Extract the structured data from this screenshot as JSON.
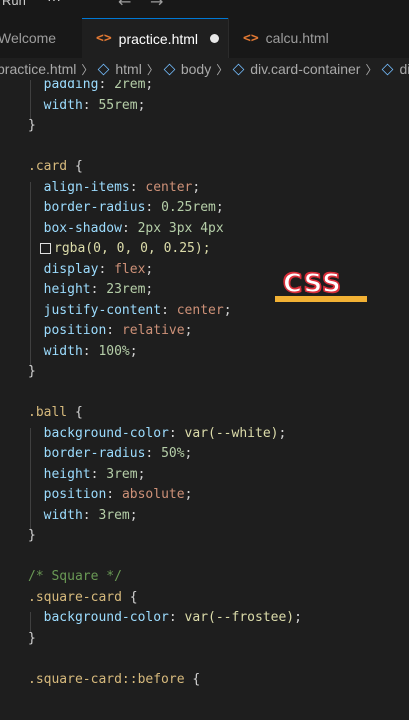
{
  "menubar": {
    "label": "Run",
    "more": "···",
    "back_icon": "arrow-left-icon",
    "forward_icon": "arrow-right-icon"
  },
  "tabs": [
    {
      "label": "Welcome",
      "active": false
    },
    {
      "label": "practice.html",
      "active": true,
      "dirty": true,
      "icon": "html-tag-icon"
    },
    {
      "label": "calcu.html",
      "active": false,
      "icon": "html-tag-icon"
    }
  ],
  "breadcrumb": [
    "practice.html",
    "html",
    "body",
    "div.card-container",
    "div"
  ],
  "badge": {
    "text": "CSS",
    "accent": "#f2b134"
  },
  "code": {
    "l1": [
      "padding",
      "2rem"
    ],
    "l2": [
      "width",
      "55rem"
    ],
    "card_selector": ".card",
    "card": [
      [
        "align-items",
        "center"
      ],
      [
        "border-radius",
        "0.25rem"
      ],
      [
        "box-shadow",
        "2px 3px 4px"
      ],
      [
        "display",
        "flex"
      ],
      [
        "height",
        "23rem"
      ],
      [
        "justify-content",
        "center"
      ],
      [
        "position",
        "relative"
      ],
      [
        "width",
        "100%"
      ]
    ],
    "shadow_rgba": "rgba(0, 0, 0, 0.25);",
    "ball_selector": ".ball",
    "ball": [
      [
        "background-color",
        "var(--white)"
      ],
      [
        "border-radius",
        "50%"
      ],
      [
        "height",
        "3rem"
      ],
      [
        "position",
        "absolute"
      ],
      [
        "width",
        "3rem"
      ]
    ],
    "comment": "/* Square */",
    "square_selector": ".square-card",
    "square": [
      [
        "background-color",
        "var(--frostee)"
      ]
    ],
    "before_selector": ".square-card::before"
  },
  "colors": {
    "background": "#1e1e1e",
    "selector": "#d7ba7d",
    "property": "#9cdcfe",
    "value": "#ce9178",
    "comment": "#6a9955"
  }
}
